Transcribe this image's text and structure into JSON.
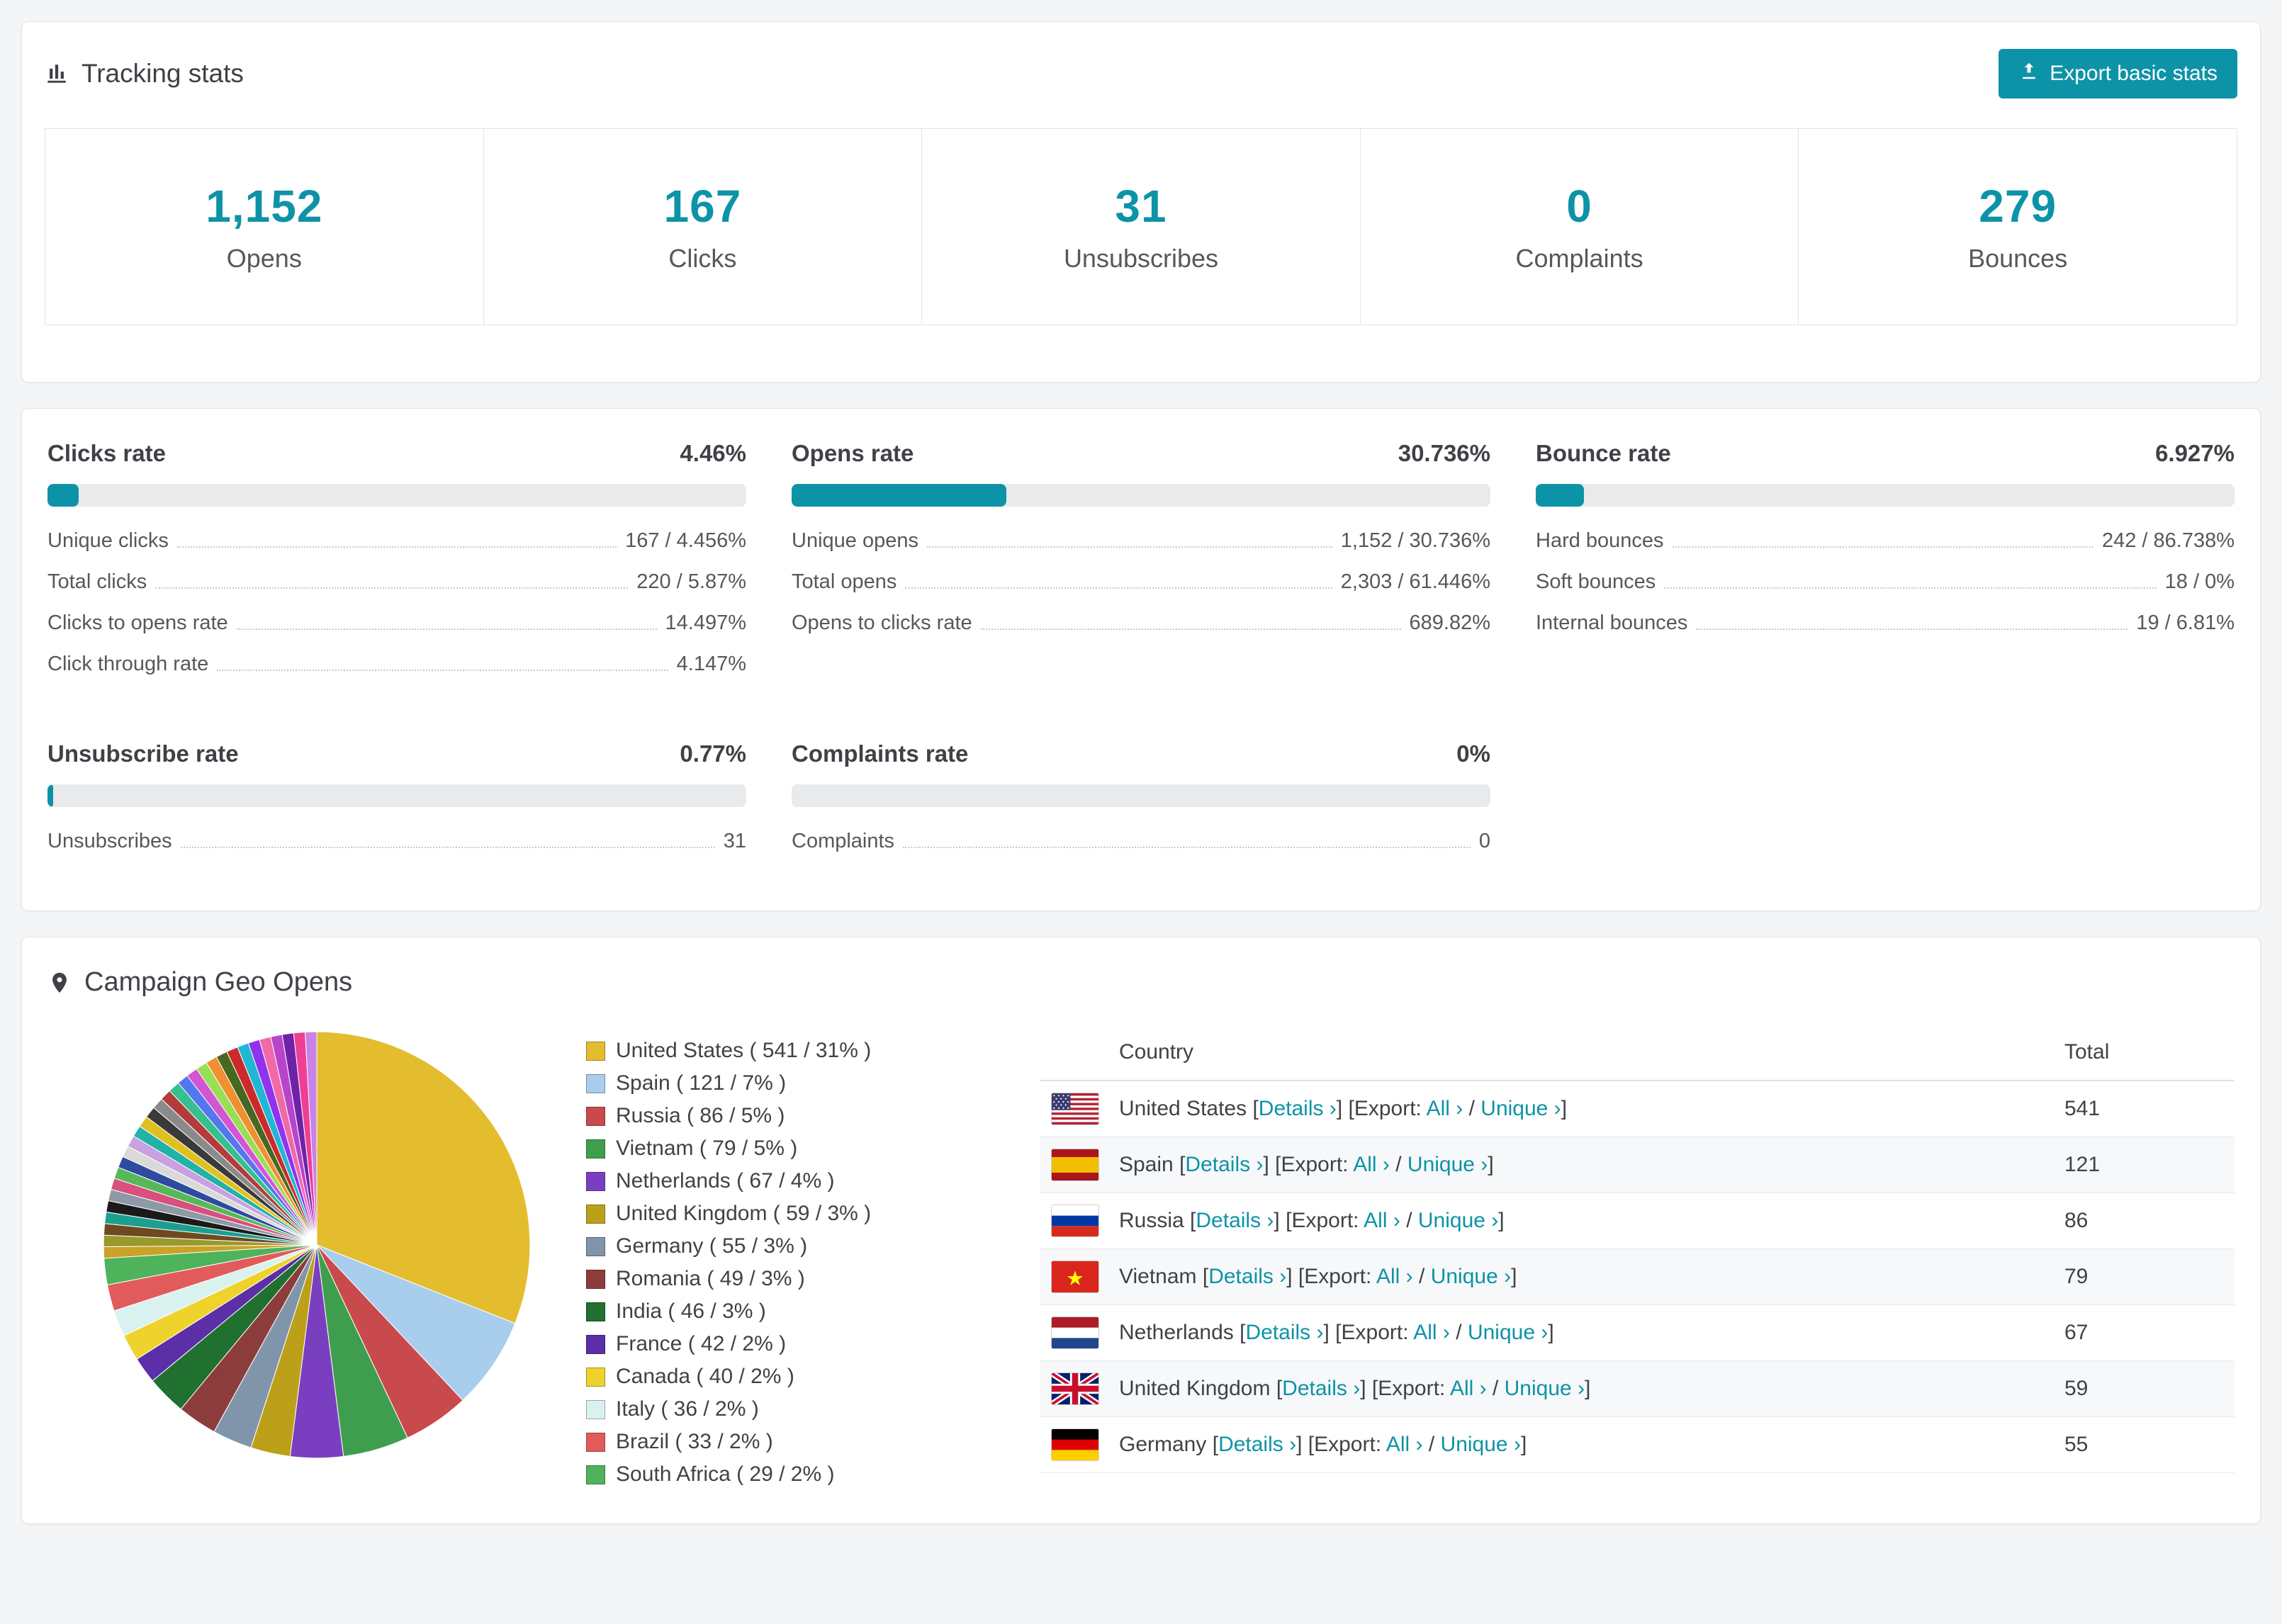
{
  "accent": "#0d93a7",
  "tracking": {
    "title": "Tracking stats",
    "export_button": "Export basic stats",
    "stats": [
      {
        "value": "1,152",
        "label": "Opens"
      },
      {
        "value": "167",
        "label": "Clicks"
      },
      {
        "value": "31",
        "label": "Unsubscribes"
      },
      {
        "value": "0",
        "label": "Complaints"
      },
      {
        "value": "279",
        "label": "Bounces"
      }
    ]
  },
  "rates": [
    {
      "title": "Clicks rate",
      "percent_label": "4.46%",
      "percent": 4.46,
      "rows": [
        {
          "label": "Unique clicks",
          "value": "167 / 4.456%"
        },
        {
          "label": "Total clicks",
          "value": "220 / 5.87%"
        },
        {
          "label": "Clicks to opens rate",
          "value": "14.497%"
        },
        {
          "label": "Click through rate",
          "value": "4.147%"
        }
      ]
    },
    {
      "title": "Opens rate",
      "percent_label": "30.736%",
      "percent": 30.736,
      "rows": [
        {
          "label": "Unique opens",
          "value": "1,152 / 30.736%"
        },
        {
          "label": "Total opens",
          "value": "2,303 / 61.446%"
        },
        {
          "label": "Opens to clicks rate",
          "value": "689.82%"
        }
      ]
    },
    {
      "title": "Bounce rate",
      "percent_label": "6.927%",
      "percent": 6.927,
      "rows": [
        {
          "label": "Hard bounces",
          "value": "242 / 86.738%"
        },
        {
          "label": "Soft bounces",
          "value": "18 / 0%"
        },
        {
          "label": "Internal bounces",
          "value": "19 / 6.81%"
        }
      ]
    },
    {
      "title": "Unsubscribe rate",
      "percent_label": "0.77%",
      "percent": 0.77,
      "rows": [
        {
          "label": "Unsubscribes",
          "value": "31"
        }
      ]
    },
    {
      "title": "Complaints rate",
      "percent_label": "0%",
      "percent": 0,
      "rows": [
        {
          "label": "Complaints",
          "value": "0"
        }
      ]
    }
  ],
  "geo": {
    "title": "Campaign Geo Opens",
    "table": {
      "country_header": "Country",
      "total_header": "Total",
      "rows": [
        {
          "country": "United States",
          "total": "541",
          "flag": "us"
        },
        {
          "country": "Spain",
          "total": "121",
          "flag": "es"
        },
        {
          "country": "Russia",
          "total": "86",
          "flag": "ru"
        },
        {
          "country": "Vietnam",
          "total": "79",
          "flag": "vn"
        },
        {
          "country": "Netherlands",
          "total": "67",
          "flag": "nl"
        },
        {
          "country": "United Kingdom",
          "total": "59",
          "flag": "gb"
        },
        {
          "country": "Germany",
          "total": "55",
          "flag": "de"
        }
      ]
    },
    "labels": {
      "lb": "[",
      "rb": "]",
      "details": "Details ›",
      "export_open": "[Export:",
      "all": "All ›",
      "slash": "/",
      "unique": "Unique ›"
    }
  },
  "chart_data": {
    "type": "pie",
    "title": "Campaign Geo Opens",
    "unit": "opens",
    "legend_position": "right-of-chart",
    "slices": [
      {
        "label": "United States",
        "value": 541,
        "percent": 31,
        "color": "#e3bd2d",
        "legend": "United States ( 541 / 31% )"
      },
      {
        "label": "Spain",
        "value": 121,
        "percent": 7,
        "color": "#a9cdec",
        "legend": "Spain ( 121 / 7% )"
      },
      {
        "label": "Russia",
        "value": 86,
        "percent": 5,
        "color": "#c94a4d",
        "legend": "Russia ( 86 / 5% )"
      },
      {
        "label": "Vietnam",
        "value": 79,
        "percent": 5,
        "color": "#3f9e4d",
        "legend": "Vietnam ( 79 / 5% )"
      },
      {
        "label": "Netherlands",
        "value": 67,
        "percent": 4,
        "color": "#7a3fc0",
        "legend": "Netherlands ( 67 / 4% )"
      },
      {
        "label": "United Kingdom",
        "value": 59,
        "percent": 3,
        "color": "#bda019",
        "legend": "United Kingdom ( 59 / 3% )"
      },
      {
        "label": "Germany",
        "value": 55,
        "percent": 3,
        "color": "#8095aa",
        "legend": "Germany ( 55 / 3% )"
      },
      {
        "label": "Romania",
        "value": 49,
        "percent": 3,
        "color": "#8d3c3c",
        "legend": "Romania ( 49 / 3% )"
      },
      {
        "label": "India",
        "value": 46,
        "percent": 3,
        "color": "#20702f",
        "legend": "India ( 46 / 3% )"
      },
      {
        "label": "France",
        "value": 42,
        "percent": 2,
        "color": "#5c2ea8",
        "legend": "France ( 42 / 2% )"
      },
      {
        "label": "Canada",
        "value": 40,
        "percent": 2,
        "color": "#efd22c",
        "legend": "Canada ( 40 / 2% )"
      },
      {
        "label": "Italy",
        "value": 36,
        "percent": 2,
        "color": "#d9f2ef",
        "legend": "Italy ( 36 / 2% )"
      },
      {
        "label": "Brazil",
        "value": 33,
        "percent": 2,
        "color": "#e25b5b",
        "legend": "Brazil ( 33 / 2% )"
      },
      {
        "label": "South Africa",
        "value": 29,
        "percent": 2,
        "color": "#4eb35a",
        "legend": "South Africa ( 29 / 2% )"
      }
    ],
    "other_percent": 26,
    "other_colors": [
      "#c9a227",
      "#99992c",
      "#6f4a21",
      "#1d9e8f",
      "#1a1a1a",
      "#8d9aa6",
      "#d94f7e",
      "#57b857",
      "#2e4ba0",
      "#d9d9d9",
      "#c9a0e0",
      "#22b2a6",
      "#e0c020",
      "#3a3a3a",
      "#8a8a8a",
      "#b23c3c",
      "#35c08d",
      "#5577ee",
      "#d455d4",
      "#9ade55",
      "#f09030",
      "#46691f",
      "#cc2a2a",
      "#21b7d4",
      "#8f33ee",
      "#f06aa8",
      "#b844cc",
      "#6f22a8",
      "#ee3f94",
      "#c883ea"
    ]
  }
}
